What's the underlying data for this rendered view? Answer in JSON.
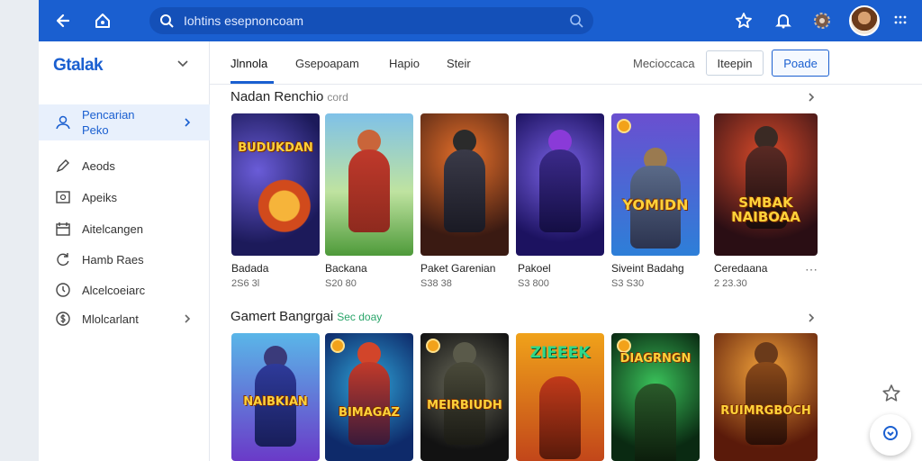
{
  "search": {
    "placeholder": "Iohtins esepnoncoam"
  },
  "sidebar": {
    "logo": "Gtalak",
    "items": [
      {
        "label": "Pencarian\nPeko",
        "icon": "user-icon",
        "active": true
      },
      {
        "label": "Aeods",
        "icon": "pen-icon"
      },
      {
        "label": "Apeiks",
        "icon": "image-icon"
      },
      {
        "label": "Aitelcangen",
        "icon": "calendar-icon"
      },
      {
        "label": "Hamb Raes",
        "icon": "refresh-icon"
      },
      {
        "label": "Alcelcoeiarc",
        "icon": "clock-icon"
      },
      {
        "label": "Mlolcarlant",
        "icon": "dollar-icon"
      }
    ]
  },
  "tabs": [
    {
      "label": "Jlnnola",
      "active": true
    },
    {
      "label": "Gsepoapam"
    },
    {
      "label": "Hapio"
    },
    {
      "label": "Steir"
    }
  ],
  "toolbar": {
    "ghost_label": "Mecioccaca",
    "secondary_label": "Iteepin",
    "primary_label": "Poade"
  },
  "section1": {
    "title": "Nadan Renchio",
    "subtitle": "cord"
  },
  "section2": {
    "title": "Gamert Bangrgai",
    "subtitle": "Sec doay"
  },
  "games_row1": [
    {
      "title": "Badada",
      "meta": "2S6 3l",
      "art": "BUDUKDAN"
    },
    {
      "title": "Backana",
      "meta": "S20 80",
      "art": ""
    },
    {
      "title": "Paket Garenian",
      "meta": "S38 38",
      "art": ""
    },
    {
      "title": "Pakoel",
      "meta": "S3 800",
      "art": ""
    },
    {
      "title": "Siveint Badahg",
      "meta": "S3 S30",
      "art": "YOMIDN"
    },
    {
      "title": "Ceredaana",
      "meta": "2 23.30",
      "art": "SMBAK NAIBOAA"
    }
  ],
  "games_row2": [
    {
      "art": "NAIBKIAN"
    },
    {
      "art": "BIMAGAZ"
    },
    {
      "art": "MEIRBIUDH"
    },
    {
      "art": "ZIEEEK"
    },
    {
      "art": "DIAGRNGN"
    },
    {
      "art": "RUIMRGBOCH"
    }
  ],
  "more_icon": "ellipsis-icon",
  "colors": {
    "brand": "#1a5fd0",
    "topbar": "#1a5fd0",
    "active_bg": "#e8f0fc"
  }
}
